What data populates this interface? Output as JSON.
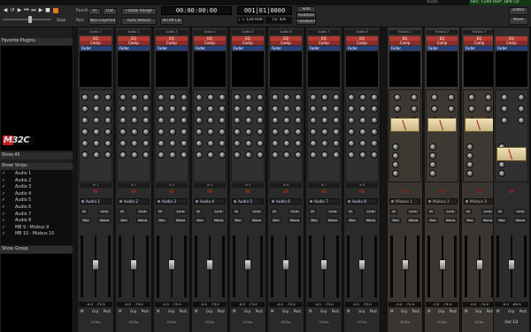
{
  "app": {
    "title": "Audio",
    "dsp_status": "Rec: >24h  DSP: 18% (2)"
  },
  "toolbar": {
    "stop_label": "Stop",
    "punch_label": "Punch:",
    "in_label": "In",
    "out_label": "Out",
    "follow_range_label": "Follow Range",
    "rec_label": "Rec:",
    "non_layered_label": "Non-Layered",
    "auto_return_label": "Auto Return",
    "int_clk_label": "INT/M-Clk",
    "timecode": "00:00:00:00",
    "bbt": "001|01|0000",
    "tempo": "♩ = 120.000",
    "meter": "TS: 4/4",
    "solo_label": "Solo",
    "audition_label": "Audition",
    "feedback_label": "Feedback",
    "editor_label": "Editor",
    "mixer_label": "Mixer"
  },
  "sidebar": {
    "favorite_plugins_label": "Favorite Plugins",
    "show_all_label": "Show All",
    "show_label": "Show",
    "strips_label": "Strips",
    "strips": [
      {
        "name": "Audio 1",
        "checked": true
      },
      {
        "name": "Audio 2",
        "checked": true
      },
      {
        "name": "Audio 3",
        "checked": true
      },
      {
        "name": "Audio 4",
        "checked": true
      },
      {
        "name": "Audio 5",
        "checked": true
      },
      {
        "name": "Audio 6",
        "checked": true
      },
      {
        "name": "Audio 7",
        "checked": true
      },
      {
        "name": "Audio 8",
        "checked": true
      },
      {
        "name": "MB 9 : Mixbus 9",
        "checked": true
      },
      {
        "name": "MB 10 : Mixbus 10",
        "checked": true
      }
    ],
    "group_label": "Group",
    "brand_text": "M32C"
  },
  "mixer": {
    "channels": [
      {
        "name": "Audio 1",
        "in": "In 1",
        "db": "-0.0",
        "peak": "-72.5"
      },
      {
        "name": "Audio 2",
        "in": "In 2",
        "db": "-0.0",
        "peak": "-73.0"
      },
      {
        "name": "Audio 3",
        "in": "In 3",
        "db": "-0.0",
        "peak": "-75.5"
      },
      {
        "name": "Audio 4",
        "in": "In 4",
        "db": "-0.0",
        "peak": "-73.0"
      },
      {
        "name": "Audio 5",
        "in": "In 5",
        "db": "-0.0",
        "peak": "-73.0"
      },
      {
        "name": "Audio 6",
        "in": "In 6",
        "db": "-0.0",
        "peak": "-72.5"
      },
      {
        "name": "Audio 7",
        "in": "In 7",
        "db": "-0.0",
        "peak": "-73.0"
      },
      {
        "name": "Audio 8",
        "in": "In 8",
        "db": "-0.0",
        "peak": "-73.0"
      }
    ],
    "buses": [
      {
        "name": "Mixbus 1",
        "db": "-0.0",
        "peak": "-74.0"
      },
      {
        "name": "Mixbus 2",
        "db": "-0.0",
        "peak": "-74.0"
      },
      {
        "name": "Mixbus 3",
        "db": "-0.0",
        "peak": "-74.0"
      }
    ],
    "master": {
      "db": "-0.0",
      "peak": "-69.5",
      "out": "Out 1/2"
    },
    "plugin_eq": "EQ",
    "plugin_comp": "Comp",
    "plugin_fader": "Fader",
    "mute_label": "M",
    "grp_label": "Grp",
    "post_label": "Post",
    "vca_label": "-VCAs-",
    "link_label": "Link",
    "rec_label": "Rec",
    "mono_label": "Mono",
    "master_label": "Mstr"
  }
}
